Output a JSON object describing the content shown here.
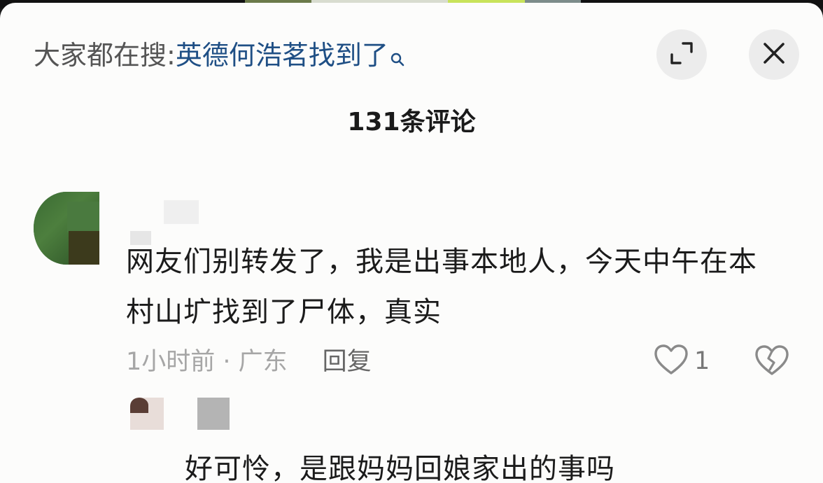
{
  "search": {
    "prefix": "大家都在搜:",
    "term": "英德何浩茗找到了"
  },
  "header": {
    "comment_count": "131条评论"
  },
  "comment": {
    "text": "网友们别转发了，我是出事本地人，今天中午在本村山圹找到了尸体，真实",
    "time_location": "1小时前 · 广东",
    "reply_label": "回复",
    "like_count": "1"
  },
  "sub_comment": {
    "text": "好可怜，是跟妈妈回娘家出的事吗"
  },
  "icons": {
    "search": "search-icon",
    "expand": "expand-icon",
    "close": "close-icon",
    "like": "heart-outline-icon",
    "dislike": "broken-heart-icon"
  },
  "colors": {
    "search_term": "#1f4f85",
    "sheet_bg": "#fcfcfb",
    "muted": "#a6a6a6"
  }
}
